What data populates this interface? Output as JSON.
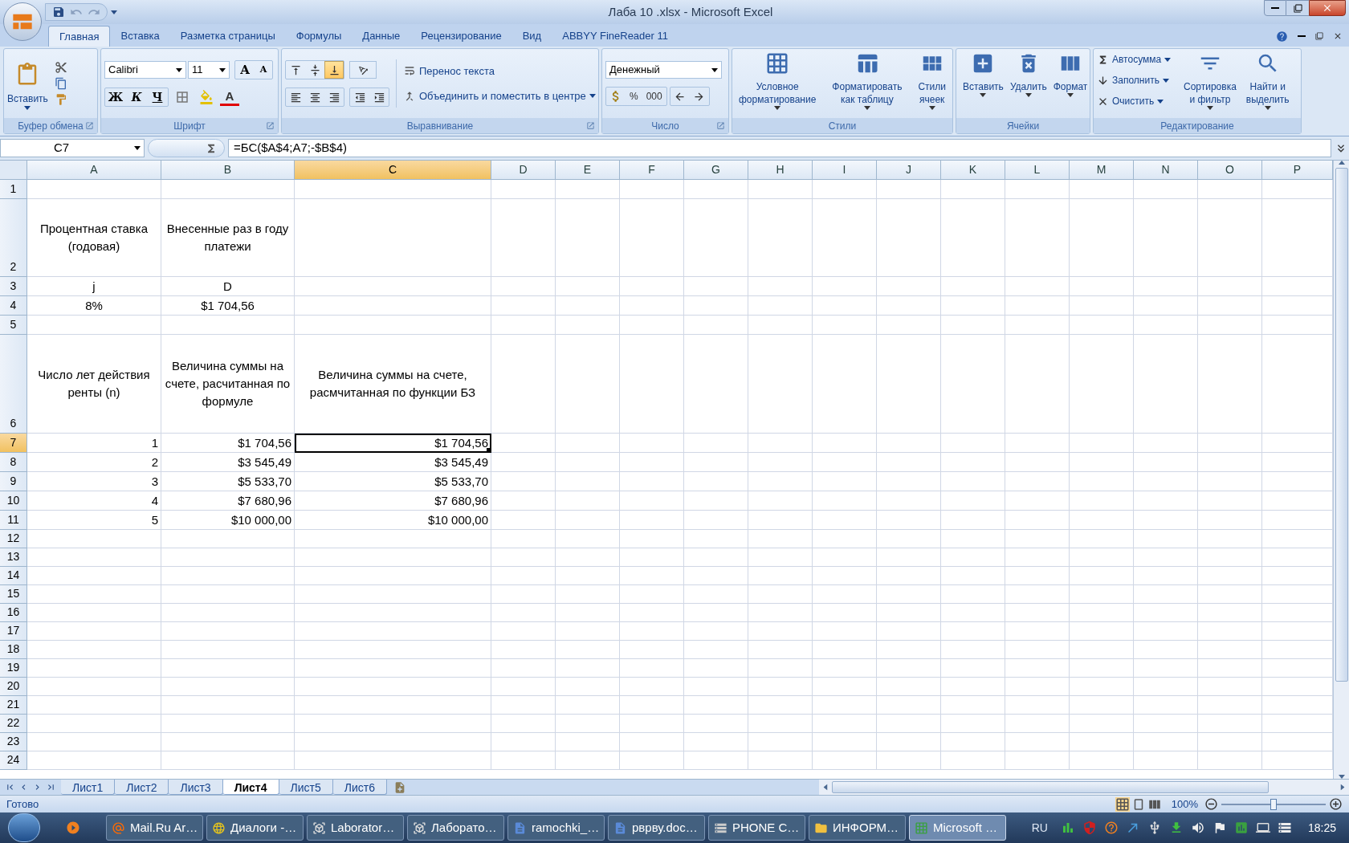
{
  "window": {
    "title": "Лаба 10 .xlsx - Microsoft Excel"
  },
  "ribbon_tabs": [
    {
      "label": "Главная",
      "selected": true
    },
    {
      "label": "Вставка",
      "selected": false
    },
    {
      "label": "Разметка страницы",
      "selected": false
    },
    {
      "label": "Формулы",
      "selected": false
    },
    {
      "label": "Данные",
      "selected": false
    },
    {
      "label": "Рецензирование",
      "selected": false
    },
    {
      "label": "Вид",
      "selected": false
    },
    {
      "label": "ABBYY FineReader 11",
      "selected": false
    }
  ],
  "clipboard": {
    "paste": "Вставить",
    "label": "Буфер обмена"
  },
  "font": {
    "name": "Calibri",
    "size": "11",
    "grow": "A",
    "shrink": "A",
    "styles": [
      "Ж",
      "К",
      "Ч"
    ],
    "color_letter": "A",
    "label": "Шрифт"
  },
  "alignment": {
    "wrap": "Перенос текста",
    "merge": "Объединить и поместить в центре",
    "label": "Выравнивание"
  },
  "number": {
    "format": "Денежный",
    "buttons": [
      "%",
      "000"
    ],
    "label": "Число"
  },
  "styles": {
    "buttons": [
      "Условное\nформатирование",
      "Форматировать\nкак таблицу",
      "Стили\nячеек"
    ],
    "label": "Стили"
  },
  "cells": {
    "buttons": [
      "Вставить",
      "Удалить",
      "Формат"
    ],
    "label": "Ячейки"
  },
  "editing": {
    "items": [
      "Автосумма",
      "Заполнить",
      "Очистить"
    ],
    "buttons": [
      "Сортировка\nи фильтр",
      "Найти и\nвыделить"
    ],
    "label": "Редактирование"
  },
  "formula_bar": {
    "name_box": "C7",
    "formula": "=БС($A$4;A7;-$B$4)"
  },
  "columns": [
    {
      "label": "A",
      "selected": false
    },
    {
      "label": "B",
      "selected": false
    },
    {
      "label": "C",
      "selected": true
    },
    {
      "label": "D",
      "selected": false
    },
    {
      "label": "E",
      "selected": false
    },
    {
      "label": "F",
      "selected": false
    },
    {
      "label": "G",
      "selected": false
    },
    {
      "label": "H",
      "selected": false
    },
    {
      "label": "I",
      "selected": false
    },
    {
      "label": "J",
      "selected": false
    },
    {
      "label": "K",
      "selected": false
    },
    {
      "label": "L",
      "selected": false
    },
    {
      "label": "M",
      "selected": false
    },
    {
      "label": "N",
      "selected": false
    },
    {
      "label": "O",
      "selected": false
    },
    {
      "label": "P",
      "selected": false
    }
  ],
  "rows": [
    {
      "label": "1",
      "selected": false
    },
    {
      "label": "2",
      "selected": false,
      "kind": "text",
      "cells": [
        {
          "text": "Процентная ставка (годовая)",
          "selected": false
        },
        {
          "text": "Внесенные раз в году платежи",
          "selected": false
        }
      ]
    },
    {
      "label": "3",
      "selected": false,
      "kind": "text",
      "cells": [
        {
          "text": "j",
          "selected": false
        },
        {
          "text": "D",
          "selected": false
        }
      ]
    },
    {
      "label": "4",
      "selected": false,
      "kind": "text",
      "cells": [
        {
          "text": "8%",
          "selected": false
        },
        {
          "text": "$1 704,56",
          "selected": false
        }
      ]
    },
    {
      "label": "5",
      "selected": false
    },
    {
      "label": "6",
      "selected": false,
      "kind": "text",
      "cells": [
        {
          "text": "Число лет действия ренты (n)",
          "selected": false
        },
        {
          "text": "Величина суммы на счете, расчитанная по формуле",
          "selected": false
        },
        {
          "text": "Величина суммы на счете, расмчитанная по функции БЗ",
          "selected": false
        }
      ]
    },
    {
      "label": "7",
      "selected": true,
      "kind": "value",
      "cells": [
        {
          "text": "1",
          "selected": false
        },
        {
          "text": "$1 704,56",
          "selected": false
        },
        {
          "text": "$1 704,56",
          "selected": true
        }
      ]
    },
    {
      "label": "8",
      "selected": false,
      "kind": "value",
      "cells": [
        {
          "text": "2",
          "selected": false
        },
        {
          "text": "$3 545,49",
          "selected": false
        },
        {
          "text": "$3 545,49",
          "selected": false
        }
      ]
    },
    {
      "label": "9",
      "selected": false,
      "kind": "value",
      "cells": [
        {
          "text": "3",
          "selected": false
        },
        {
          "text": "$5 533,70",
          "selected": false
        },
        {
          "text": "$5 533,70",
          "selected": false
        }
      ]
    },
    {
      "label": "10",
      "selected": false,
      "kind": "value",
      "cells": [
        {
          "text": "4",
          "selected": false
        },
        {
          "text": "$7 680,96",
          "selected": false
        },
        {
          "text": "$7 680,96",
          "selected": false
        }
      ]
    },
    {
      "label": "11",
      "selected": false,
      "kind": "value",
      "cells": [
        {
          "text": "5",
          "selected": false
        },
        {
          "text": "$10 000,00",
          "selected": false
        },
        {
          "text": "$10 000,00",
          "selected": false
        }
      ]
    },
    {
      "label": "12",
      "selected": false
    },
    {
      "label": "13",
      "selected": false
    },
    {
      "label": "14",
      "selected": false
    },
    {
      "label": "15",
      "selected": false
    },
    {
      "label": "16",
      "selected": false
    },
    {
      "label": "17",
      "selected": false
    },
    {
      "label": "18",
      "selected": false
    },
    {
      "label": "19",
      "selected": false
    },
    {
      "label": "20",
      "selected": false
    },
    {
      "label": "21",
      "selected": false
    },
    {
      "label": "22",
      "selected": false
    },
    {
      "label": "23",
      "selected": false
    },
    {
      "label": "24",
      "selected": false
    }
  ],
  "sheet_tabs": [
    {
      "label": "Лист1",
      "selected": false
    },
    {
      "label": "Лист2",
      "selected": false
    },
    {
      "label": "Лист3",
      "selected": false
    },
    {
      "label": "Лист4",
      "selected": true
    },
    {
      "label": "Лист5",
      "selected": false
    },
    {
      "label": "Лист6",
      "selected": false
    }
  ],
  "status_bar": {
    "status": "Готово",
    "zoom": "100%",
    "zoom_level": {
      "level": 0.5
    }
  },
  "taskbar": {
    "buttons": [
      {
        "label": "Mail.Ru Ar…",
        "kind": "mail",
        "selected": false
      },
      {
        "label": "Диалоги -…",
        "kind": "browser",
        "selected": false
      },
      {
        "label": "Laborator…",
        "kind": "app",
        "selected": false
      },
      {
        "label": "Лаборато…",
        "kind": "app",
        "selected": false
      },
      {
        "label": "ramochki_…",
        "kind": "doc",
        "selected": false
      },
      {
        "label": "рврву.doc…",
        "kind": "doc",
        "selected": false
      },
      {
        "label": "PHONE C…",
        "kind": "drive",
        "selected": false
      },
      {
        "label": "ИНФОРМ…",
        "kind": "folder",
        "selected": false
      },
      {
        "label": "Microsoft …",
        "kind": "sheet",
        "selected": true
      }
    ],
    "language": "RU",
    "clock": "18:25"
  }
}
